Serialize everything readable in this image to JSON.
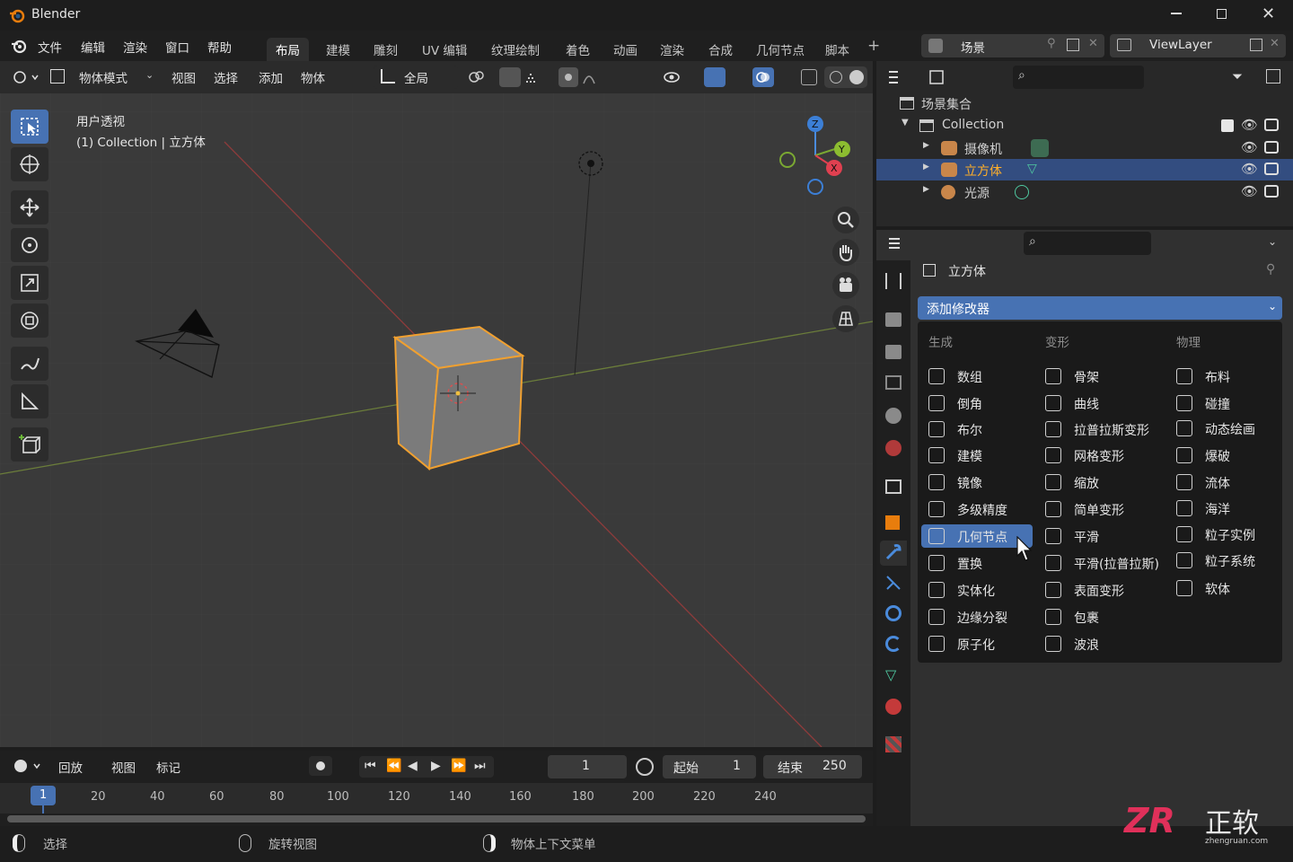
{
  "titlebar": {
    "app_title": "Blender"
  },
  "menu": [
    "文件",
    "编辑",
    "渲染",
    "窗口",
    "帮助"
  ],
  "workspaces": [
    "布局",
    "建模",
    "雕刻",
    "UV 编辑",
    "纹理绘制",
    "着色",
    "动画",
    "渲染",
    "合成",
    "几何节点",
    "脚本"
  ],
  "active_workspace": "布局",
  "scene": {
    "name": "场景",
    "view_layer": "ViewLayer"
  },
  "viewport_header": {
    "mode": "物体模式",
    "menus": [
      "视图",
      "选择",
      "添加",
      "物体"
    ],
    "transform": "全局"
  },
  "viewport": {
    "view_name": "用户透视",
    "context": "(1) Collection | 立方体"
  },
  "outliner": {
    "root": "场景集合",
    "collection": "Collection",
    "items": [
      {
        "name": "摄像机",
        "selected": false,
        "icon": "camera-icon"
      },
      {
        "name": "立方体",
        "selected": true,
        "icon": "mesh-icon"
      },
      {
        "name": "光源",
        "selected": false,
        "icon": "light-icon"
      }
    ]
  },
  "properties": {
    "object_name": "立方体",
    "add_modifier": "添加修改器",
    "categories": [
      "生成",
      "变形",
      "物理"
    ],
    "generate": [
      "数组",
      "倒角",
      "布尔",
      "建模",
      "镜像",
      "多级精度",
      "几何节点",
      "置换",
      "实体化",
      "边缘分裂",
      "原子化"
    ],
    "deform": [
      "骨架",
      "曲线",
      "拉普拉斯变形",
      "网格变形",
      "缩放",
      "简单变形",
      "平滑",
      "平滑(拉普拉斯)",
      "表面变形",
      "包裹",
      "波浪"
    ],
    "physics": [
      "布料",
      "碰撞",
      "动态绘画",
      "爆破",
      "流体",
      "海洋",
      "粒子实例",
      "粒子系统",
      "软体"
    ],
    "highlighted": "几何节点"
  },
  "timeline": {
    "menus": [
      "回放",
      "视图",
      "标记"
    ],
    "current_frame": "1",
    "start_label": "起始",
    "start": "1",
    "end_label": "结束",
    "end": "250",
    "ticks": [
      "20",
      "40",
      "60",
      "80",
      "100",
      "120",
      "140",
      "160",
      "180",
      "200",
      "220",
      "240"
    ],
    "playhead": "1"
  },
  "statusbar": {
    "items": [
      "选择",
      "旋转视图",
      "物体上下文菜单"
    ]
  },
  "watermark": {
    "brand": "ZR",
    "text": "正软",
    "url": "zhengruan.com"
  },
  "colors": {
    "accent": "#4772b3",
    "selection_outline": "#f0a030",
    "background": "#3a3a3a"
  }
}
